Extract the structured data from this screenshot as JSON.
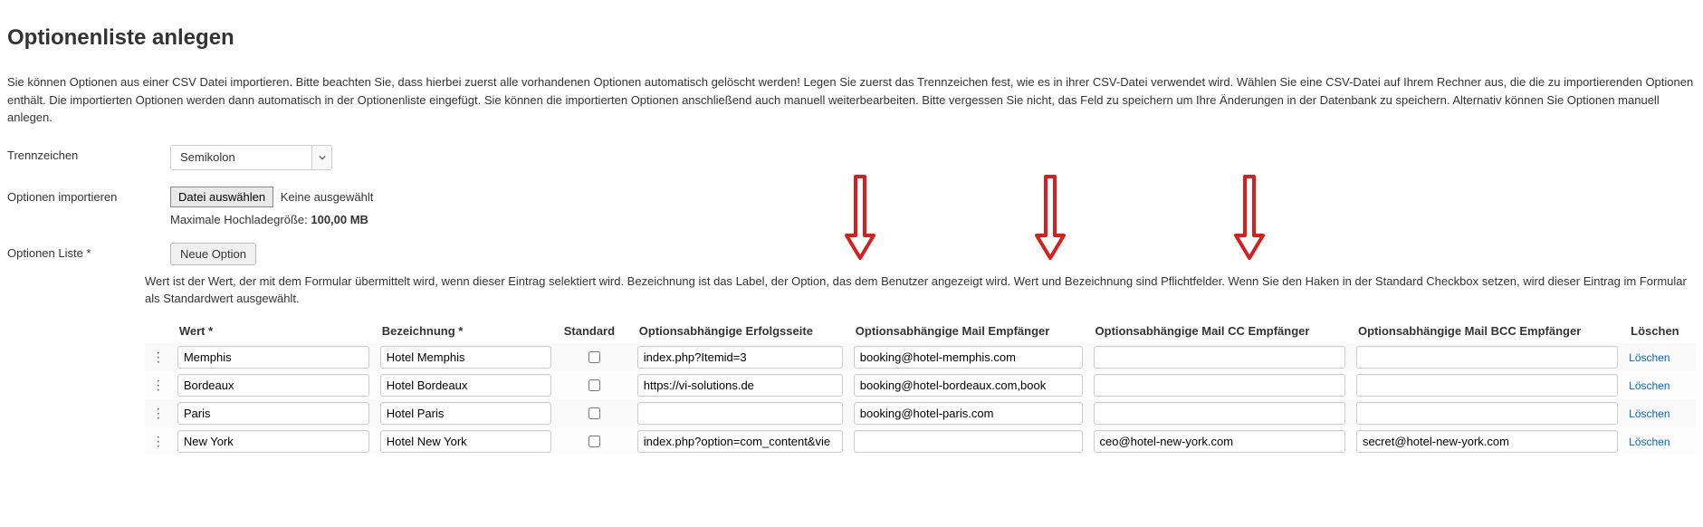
{
  "title": "Optionenliste anlegen",
  "intro": "Sie können Optionen aus einer CSV Datei importieren. Bitte beachten Sie, dass hierbei zuerst alle vorhandenen Optionen automatisch gelöscht werden! Legen Sie zuerst das Trennzeichen fest, wie es in ihrer CSV-Datei verwendet wird. Wählen Sie eine CSV-Datei auf Ihrem Rechner aus, die die zu importierenden Optionen enthält. Die importierten Optionen werden dann automatisch in der Optionenliste eingefügt. Sie können die importierten Optionen anschließend auch manuell weiterbearbeiten. Bitte vergessen Sie nicht, das Feld zu speichern um Ihre Änderungen in der Datenbank zu speichern. Alternativ können Sie Optionen manuell anlegen.",
  "labels": {
    "trennzeichen": "Trennzeichen",
    "import": "Optionen importieren",
    "liste": "Optionen Liste *"
  },
  "trennzeichen_value": "Semikolon",
  "file": {
    "button": "Datei auswählen",
    "status": "Keine ausgewählt",
    "maxsize_label": "Maximale Hochladegröße:",
    "maxsize_value": "100,00 MB"
  },
  "new_option_label": "Neue Option",
  "help_text": "Wert ist der Wert, der mit dem Formular übermittelt wird, wenn dieser Eintrag selektiert wird. Bezeichnung ist das Label, der Option, das dem Benutzer angezeigt wird. Wert und Bezeichnung sind Pflichtfelder. Wenn Sie den Haken in der Standard Checkbox setzen, wird dieser Eintrag im Formular als Standardwert ausgewählt.",
  "columns": {
    "wert": "Wert *",
    "bezeichnung": "Bezeichnung *",
    "standard": "Standard",
    "page": "Optionsabhängige Erfolgsseite",
    "mail": "Optionsabhängige Mail Empfänger",
    "cc": "Optionsabhängige Mail CC Empfänger",
    "bcc": "Optionsabhängige Mail BCC Empfänger",
    "delete": "Löschen"
  },
  "delete_label": "Löschen",
  "rows": [
    {
      "wert": "Memphis",
      "bez": "Hotel Memphis",
      "std": false,
      "page": "index.php?Itemid=3",
      "mail": "booking@hotel-memphis.com",
      "cc": "",
      "bcc": ""
    },
    {
      "wert": "Bordeaux",
      "bez": "Hotel Bordeaux",
      "std": false,
      "page": "https://vi-solutions.de",
      "mail": "booking@hotel-bordeaux.com,book",
      "cc": "",
      "bcc": ""
    },
    {
      "wert": "Paris",
      "bez": "Hotel Paris",
      "std": false,
      "page": "",
      "mail": "booking@hotel-paris.com",
      "cc": "",
      "bcc": ""
    },
    {
      "wert": "New York",
      "bez": "Hotel New York",
      "std": false,
      "page": "index.php?option=com_content&vie",
      "mail": "",
      "cc": "ceo@hotel-new-york.com",
      "bcc": "secret@hotel-new-york.com"
    }
  ]
}
